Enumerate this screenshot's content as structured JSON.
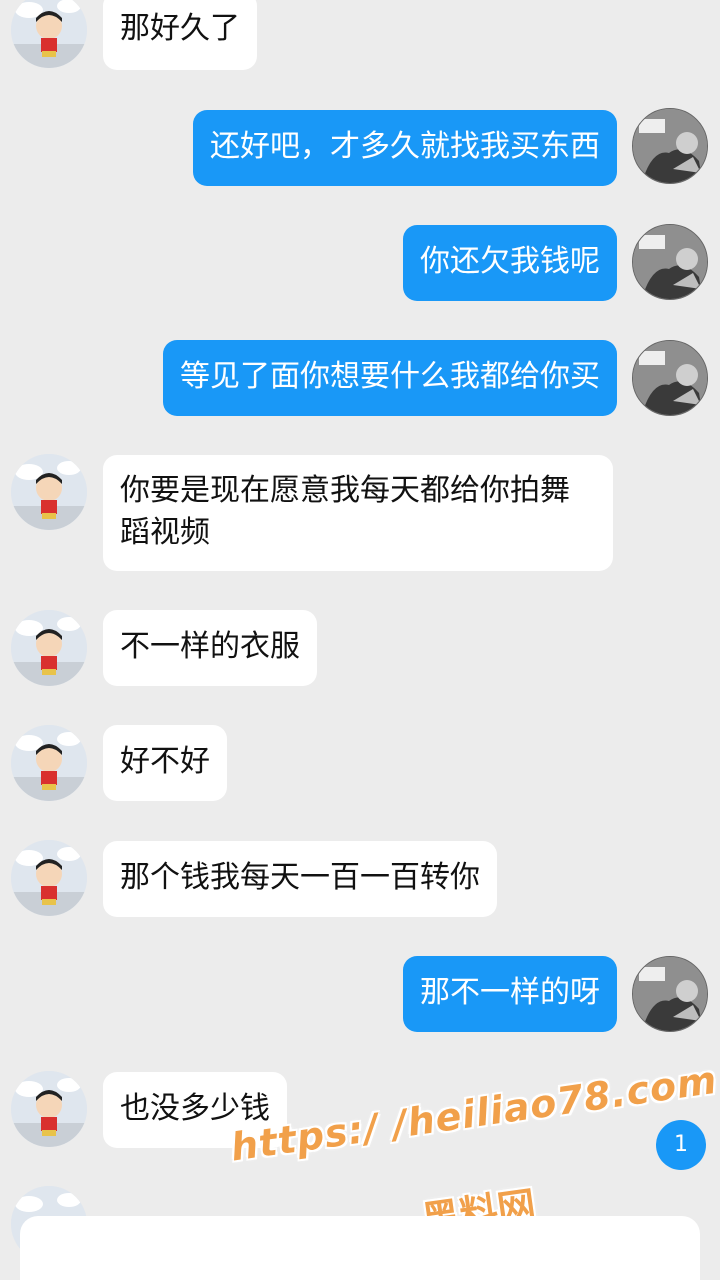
{
  "messages": [
    {
      "side": "in",
      "text": "那好久了"
    },
    {
      "side": "out",
      "text": "还好吧，才多久就找我买东西"
    },
    {
      "side": "out",
      "text": "你还欠我钱呢"
    },
    {
      "side": "out",
      "text": "等见了面你想要什么我都给你买"
    },
    {
      "side": "in",
      "text": "你要是现在愿意我每天都给你拍舞蹈视频"
    },
    {
      "side": "in",
      "text": "不一样的衣服"
    },
    {
      "side": "in",
      "text": "好不好"
    },
    {
      "side": "in",
      "text": "那个钱我每天一百一百转你"
    },
    {
      "side": "out",
      "text": "那不一样的呀"
    },
    {
      "side": "in",
      "text": "也没多少钱"
    }
  ],
  "unread_count": "1",
  "watermark": {
    "url": "https:/ /heiliao78.com",
    "name": "黑料网"
  },
  "colors": {
    "background": "#ececec",
    "outgoing_bubble": "#1998f7",
    "incoming_bubble": "#ffffff",
    "watermark": "#f1a04a"
  }
}
